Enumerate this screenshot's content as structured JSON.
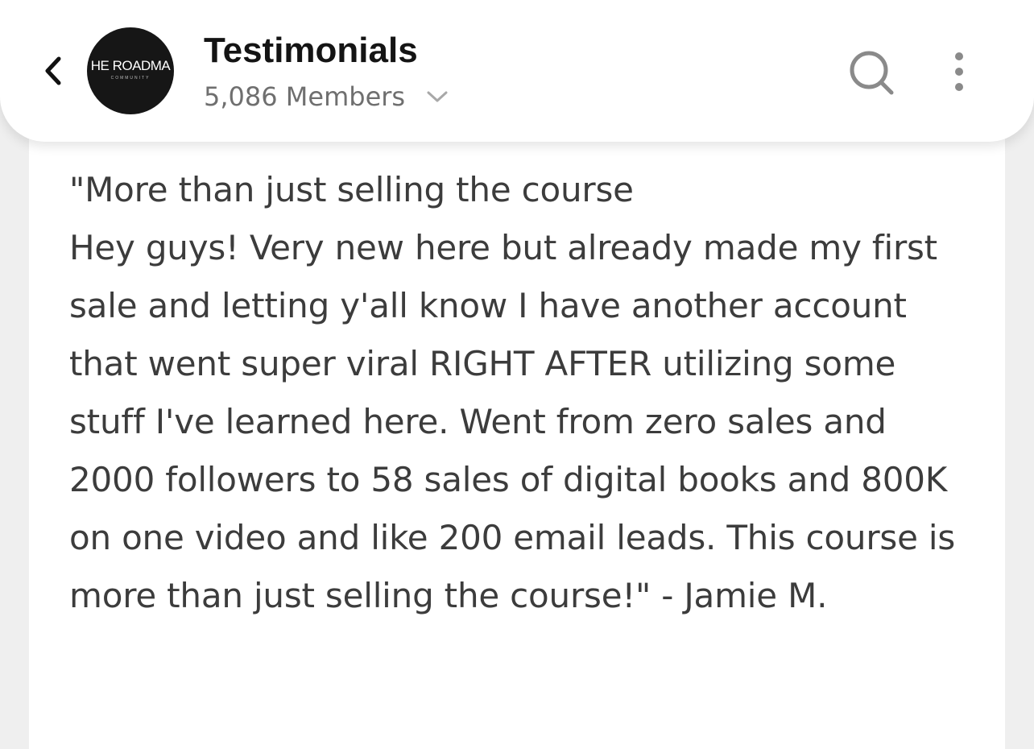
{
  "header": {
    "title": "Testimonials",
    "members": "5,086 Members",
    "avatar_title": "HE ROADMA",
    "avatar_subtitle": "COMMUNITY"
  },
  "message": {
    "text": "\"More than just selling the course\nHey guys! Very new here but already made my first sale and letting y'all know I have another account that went super viral RIGHT AFTER utilizing some stuff I've learned here. Went from zero sales and 2000 followers to 58 sales of digital books and 800K on one video and like 200 email leads. This course is more than just selling the course!\" - Jamie M."
  },
  "icons": {
    "back": "chevron-left-icon",
    "dropdown": "chevron-down-icon",
    "search": "search-icon",
    "more": "more-vertical-icon"
  },
  "colors": {
    "background": "#efefef",
    "card": "#ffffff",
    "header": "#ffffff",
    "title": "#141414",
    "muted": "#6f6f6f",
    "body_text": "#3c3c3c",
    "icon_gray": "#8a8a8a",
    "avatar_bg": "#161616"
  }
}
